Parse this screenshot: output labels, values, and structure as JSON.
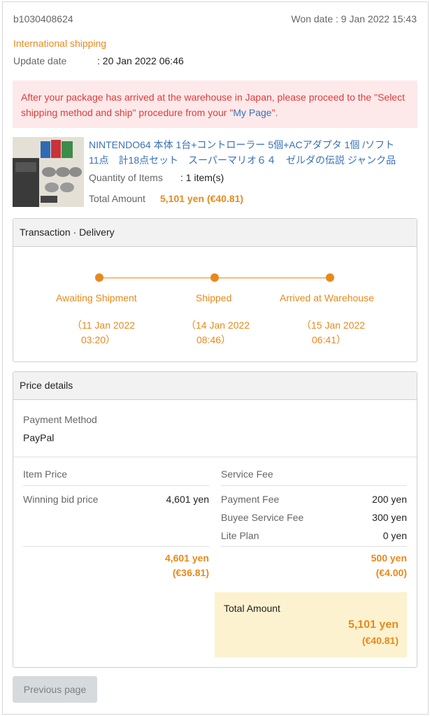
{
  "order": {
    "id": "b1030408624",
    "won_date_label": "Won date : 9 Jan 2022 15:43",
    "shipping_type": "International shipping",
    "update_label": "Update date",
    "update_value": ": 20 Jan 2022 06:46"
  },
  "notice": {
    "text_before": "After your package has arrived at the warehouse in Japan, please proceed to the \"Select shipping method and ship\" procedure from your \"",
    "link": "My Page",
    "text_after": "\"."
  },
  "item": {
    "title_line1": "NINTENDO64 本体 1台+コントローラー 5個+ACアダプタ 1個 /ソフト",
    "title_line2": "11点　計18点セット　スーパーマリオ６４　ゼルダの伝説 ジャンク品",
    "qty_label": "Quantity of Items",
    "qty_value": ": 1 item(s)",
    "total_label": "Total Amount",
    "total_value": "5,101 yen (€40.81)"
  },
  "transaction": {
    "title": "Transaction · Delivery",
    "steps": [
      {
        "label": "Awaiting Shipment",
        "date1": "（11 Jan 2022",
        "date2": "03:20）"
      },
      {
        "label": "Shipped",
        "date1": "（14 Jan 2022",
        "date2": "08:46）"
      },
      {
        "label": "Arrived at Warehouse",
        "date1": "（15 Jan 2022",
        "date2": "06:41）"
      }
    ]
  },
  "price": {
    "title": "Price details",
    "payment_method_label": "Payment Method",
    "payment_method_value": "PayPal",
    "item_price_header": "Item Price",
    "winning_bid_label": "Winning bid price",
    "winning_bid_value": "4,601 yen",
    "item_total_yen": "4,601 yen",
    "item_total_eur": "(€36.81)",
    "service_fee_header": "Service Fee",
    "fees": [
      {
        "label": "Payment Fee",
        "value": "200 yen"
      },
      {
        "label": "Buyee Service Fee",
        "value": "300 yen"
      },
      {
        "label": "Lite Plan",
        "value": "0 yen"
      }
    ],
    "fee_total_yen": "500 yen",
    "fee_total_eur": "(€4.00)",
    "total_label": "Total Amount",
    "total_yen": "5,101 yen",
    "total_eur": "(€40.81)"
  },
  "nav": {
    "previous": "Previous page"
  }
}
